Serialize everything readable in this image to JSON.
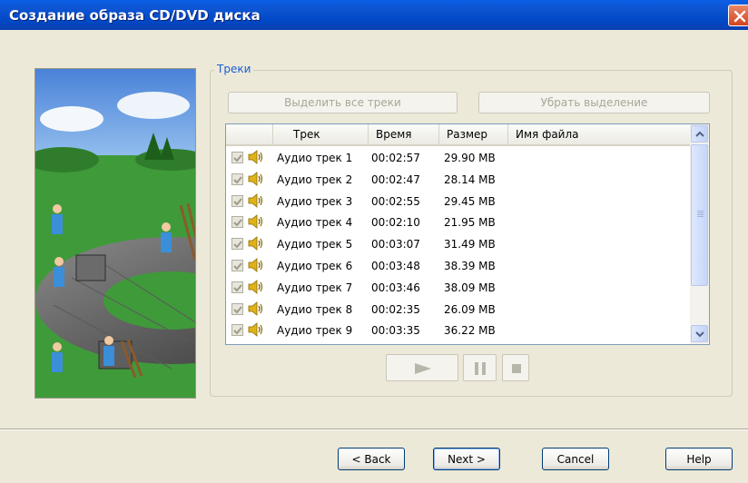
{
  "window": {
    "title": "Создание образа CD/DVD диска"
  },
  "tracks_group": {
    "title": "Треки",
    "select_all_label": "Выделить все треки",
    "deselect_label": "Убрать выделение"
  },
  "list": {
    "columns": [
      "Трек",
      "Время",
      "Размер",
      "Имя файла"
    ],
    "rows": [
      {
        "track": "Аудио трек 1",
        "time": "00:02:57",
        "size": "29.90 MB",
        "file": "",
        "checked": true
      },
      {
        "track": "Аудио трек 2",
        "time": "00:02:47",
        "size": "28.14 MB",
        "file": "",
        "checked": true
      },
      {
        "track": "Аудио трек 3",
        "time": "00:02:55",
        "size": "29.45 MB",
        "file": "",
        "checked": true
      },
      {
        "track": "Аудио трек 4",
        "time": "00:02:10",
        "size": "21.95 MB",
        "file": "",
        "checked": true
      },
      {
        "track": "Аудио трек 5",
        "time": "00:03:07",
        "size": "31.49 MB",
        "file": "",
        "checked": true
      },
      {
        "track": "Аудио трек 6",
        "time": "00:03:48",
        "size": "38.39 MB",
        "file": "",
        "checked": true
      },
      {
        "track": "Аудио трек 7",
        "time": "00:03:46",
        "size": "38.09 MB",
        "file": "",
        "checked": true
      },
      {
        "track": "Аудио трек 8",
        "time": "00:02:35",
        "size": "26.09 MB",
        "file": "",
        "checked": true
      },
      {
        "track": "Аудио трек 9",
        "time": "00:03:35",
        "size": "36.22 MB",
        "file": "",
        "checked": true
      }
    ]
  },
  "player": {
    "icons": [
      "play-icon",
      "pause-icon",
      "stop-icon"
    ]
  },
  "buttons": {
    "back": "< Back",
    "next": "Next >",
    "cancel": "Cancel",
    "help": "Help"
  },
  "colors": {
    "titlebar": "#0148c7",
    "window_bg": "#ece9d8",
    "group_title": "#1a5ed2",
    "disabled_text": "#a9a795",
    "close_button": "#d2441f"
  }
}
